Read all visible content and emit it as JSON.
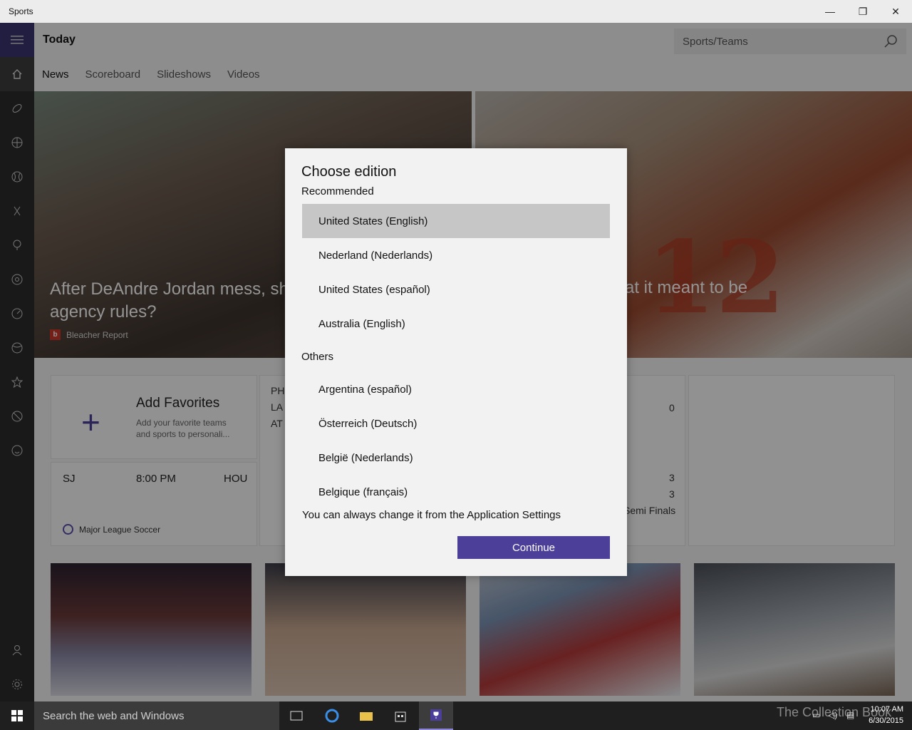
{
  "window": {
    "title": "Sports",
    "minimize": "—",
    "restore": "❐",
    "close": "✕"
  },
  "header": {
    "title": "Today"
  },
  "search": {
    "placeholder": "Sports/Teams"
  },
  "tabs": [
    {
      "label": "News"
    },
    {
      "label": "Scoreboard"
    },
    {
      "label": "Slideshows"
    },
    {
      "label": "Videos"
    }
  ],
  "hero": {
    "left_headline": "After DeAndre Jordan mess, should NBA alter free agency rules?",
    "left_source": "Bleacher Report",
    "left_logo": "b",
    "right_headline_fragment": "at it meant to be",
    "right_jersey": "12"
  },
  "favorites": {
    "plus": "+",
    "title": "Add Favorites",
    "subtitle": "Add your favorite teams and sports to personali..."
  },
  "match": {
    "home": "SJ",
    "time": "8:00 PM",
    "away": "HOU",
    "league": "Major League Soccer"
  },
  "score_tile": {
    "rows": [
      "PH",
      "LA",
      "AT"
    ]
  },
  "score_right": {
    "top_value": "0",
    "values": [
      "3",
      "3"
    ],
    "label": "Semi Finals"
  },
  "dialog": {
    "title": "Choose edition",
    "recommended_label": "Recommended",
    "recommended": [
      "United States (English)",
      "Nederland (Nederlands)",
      "United States (español)",
      "Australia (English)"
    ],
    "others_label": "Others",
    "others": [
      "Argentina (español)",
      "Österreich (Deutsch)",
      "België (Nederlands)",
      "Belgique (français)"
    ],
    "selected": "United States (English)",
    "note": "You can always change it from the Application Settings",
    "continue_label": "Continue"
  },
  "taskbar": {
    "search_placeholder": "Search the web and Windows",
    "time": "10:07 AM",
    "date": "6/30/2015",
    "watermark": "The Collection Book"
  },
  "colors": {
    "accent": "#4b3f9a",
    "selected_row": "#c6c6c6",
    "rail": "#2b2b2b"
  }
}
